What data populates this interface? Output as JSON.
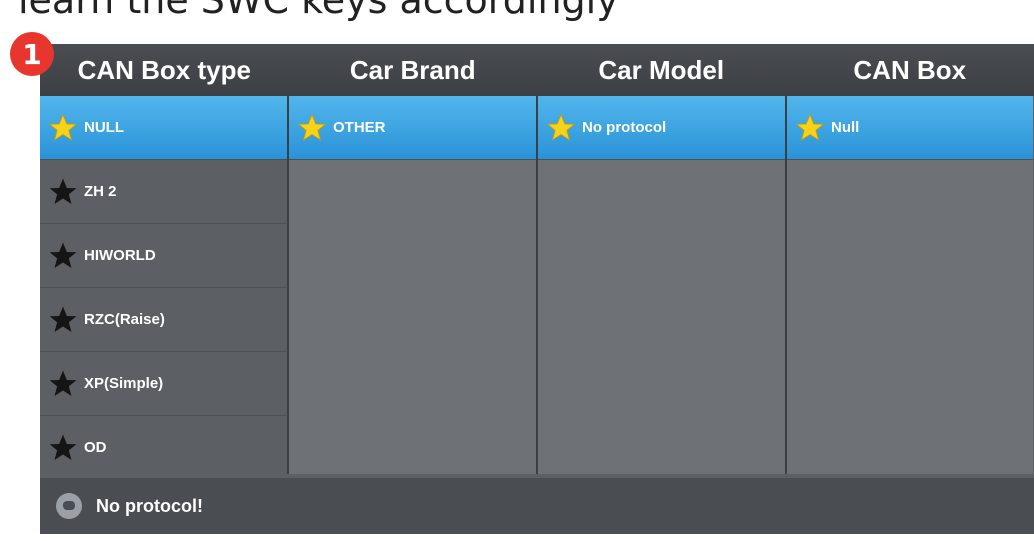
{
  "caption": "learn the SWC keys accordingly",
  "step_badge": "1",
  "headers": [
    "CAN Box type",
    "Car Brand",
    "Car Model",
    "CAN Box"
  ],
  "columns": {
    "can_box_type": [
      "NULL",
      "ZH 2",
      "HIWORLD",
      "RZC(Raise)",
      "XP(Simple)",
      "OD"
    ],
    "car_brand": [
      "OTHER"
    ],
    "car_model": [
      "No protocol"
    ],
    "can_box": [
      "Null"
    ]
  },
  "selected_color": "#2a93d8",
  "icons": {
    "selected": "star-yellow-icon",
    "unselected": "star-black-icon",
    "status": "message-icon"
  },
  "status": "No protocol!"
}
